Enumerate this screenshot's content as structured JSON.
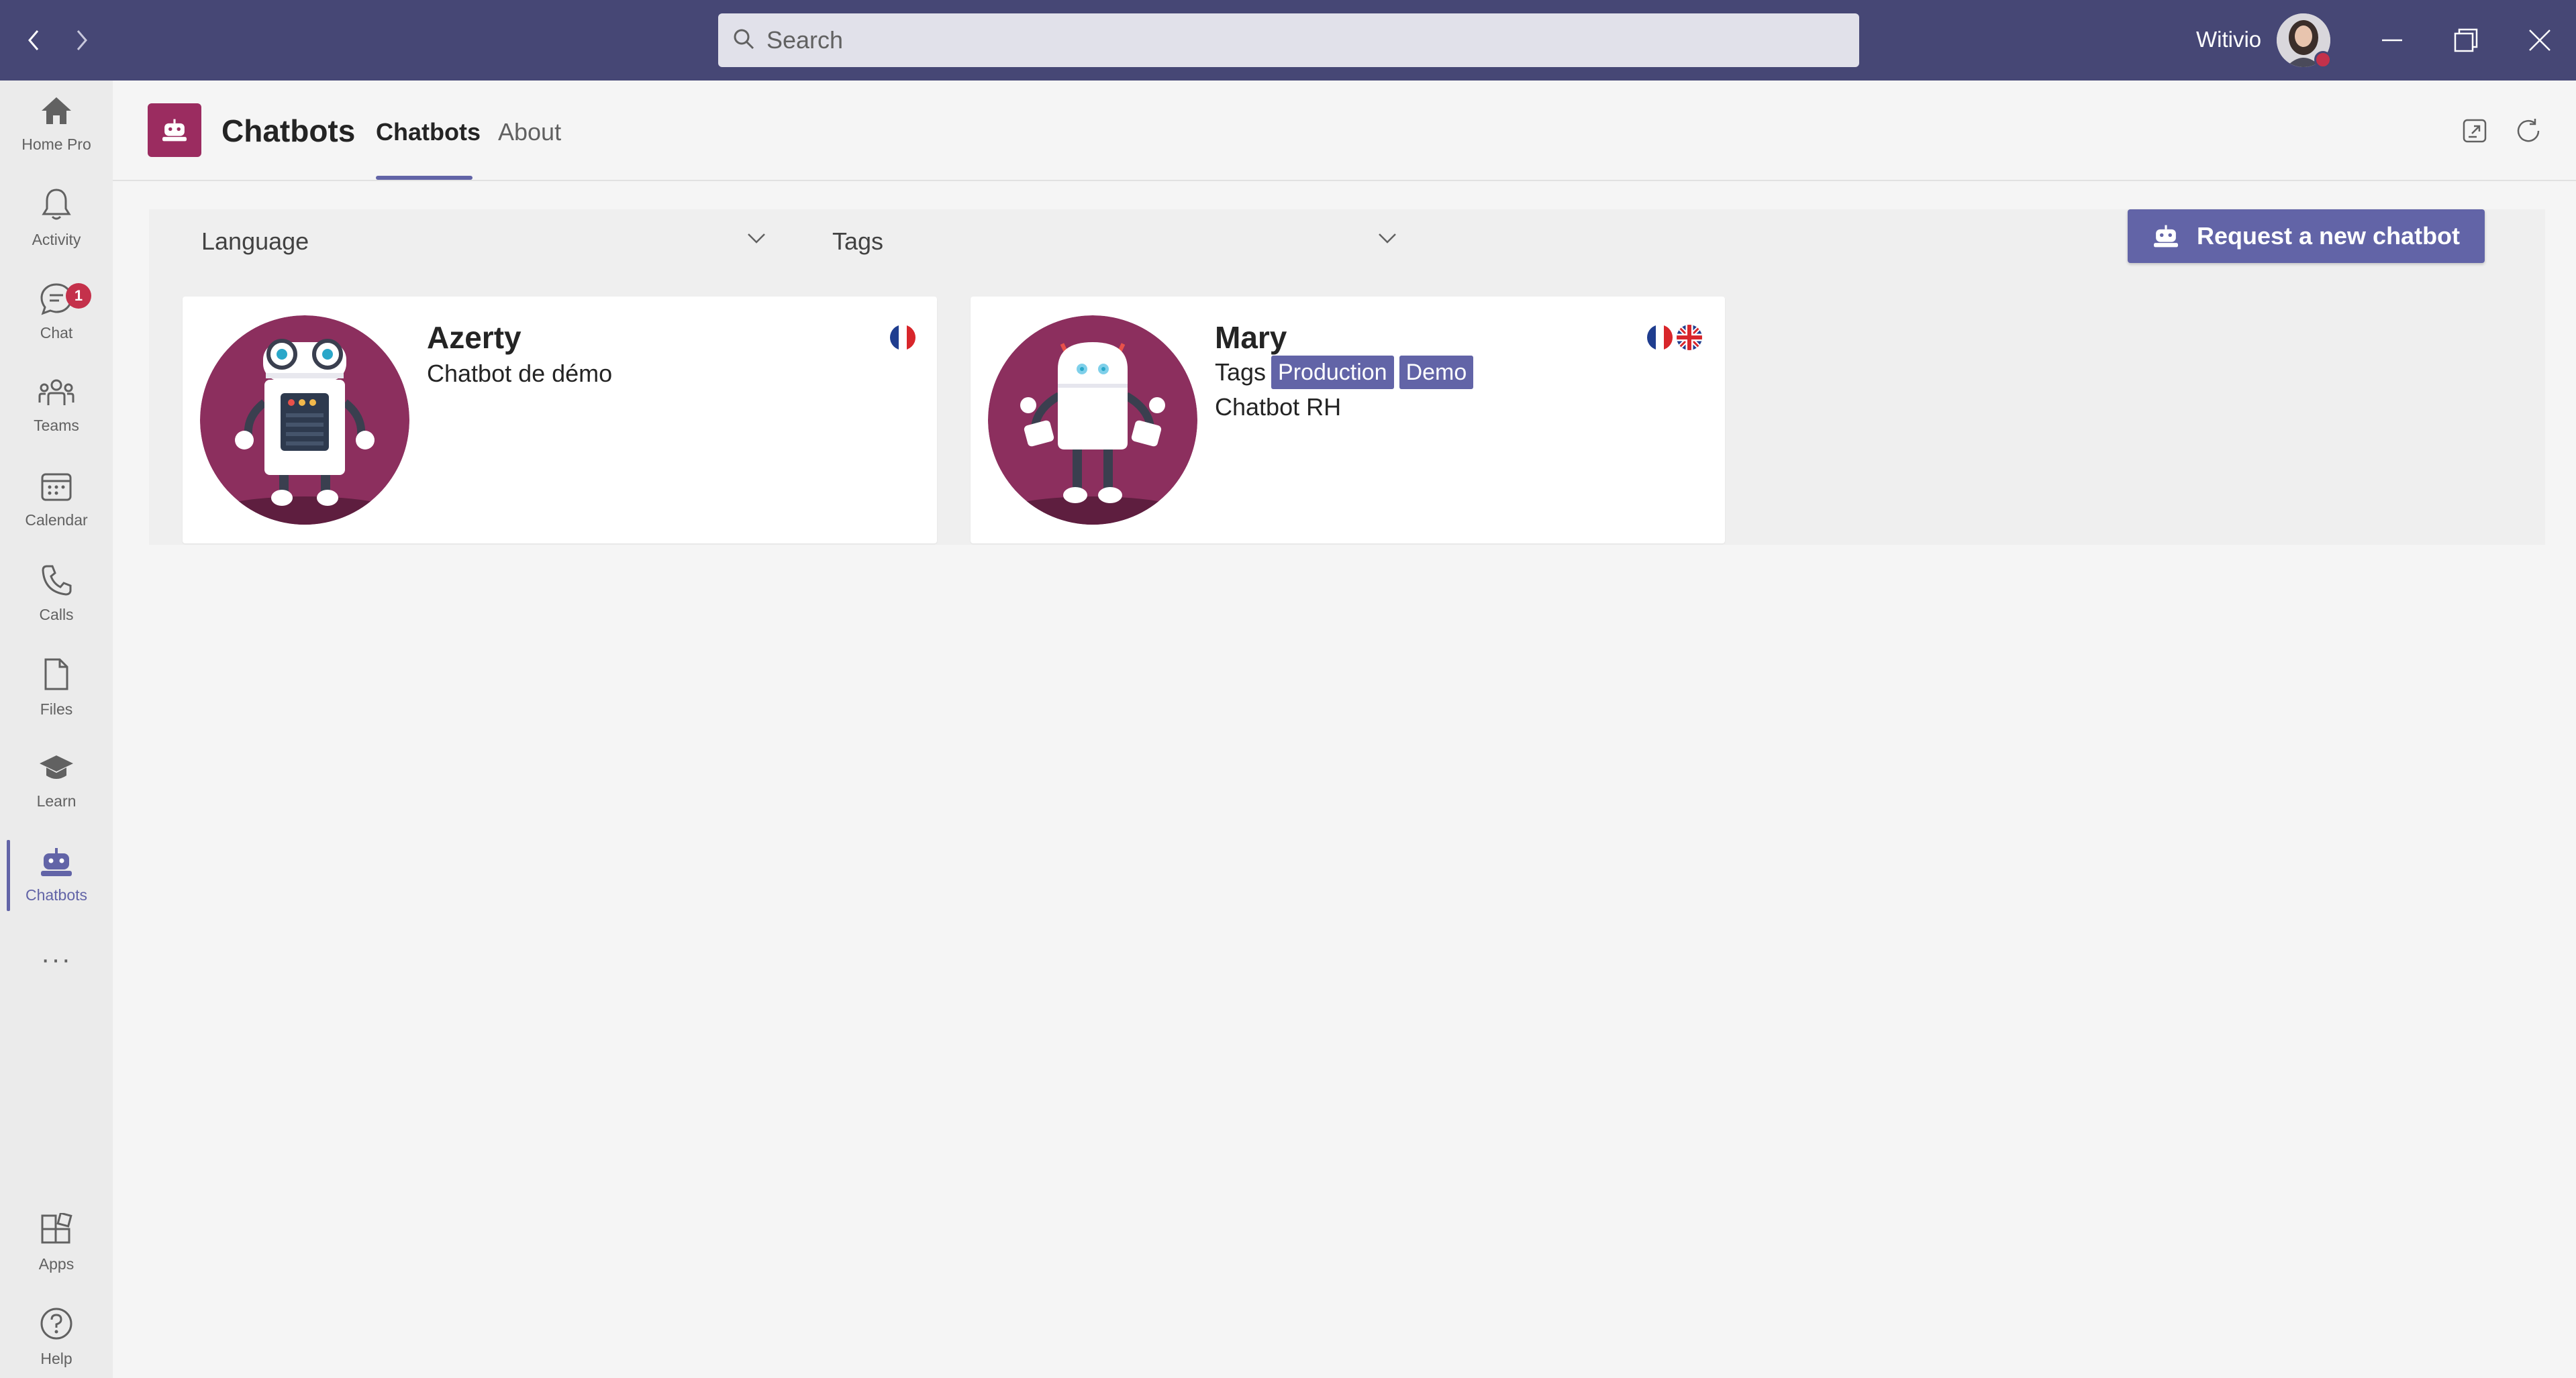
{
  "titlebar": {
    "search_placeholder": "Search",
    "username": "Witivio",
    "back_icon": "chevron-left-icon",
    "forward_icon": "chevron-right-icon",
    "colors": {
      "titlebar": "#464775",
      "accent": "#6264a7",
      "status_busy": "#c4314b"
    }
  },
  "rail": {
    "items": [
      {
        "label": "Home Pro",
        "icon": "home-icon"
      },
      {
        "label": "Activity",
        "icon": "bell-icon"
      },
      {
        "label": "Chat",
        "icon": "chat-icon",
        "badge": "1"
      },
      {
        "label": "Teams",
        "icon": "teams-icon"
      },
      {
        "label": "Calendar",
        "icon": "calendar-icon"
      },
      {
        "label": "Calls",
        "icon": "phone-icon"
      },
      {
        "label": "Files",
        "icon": "file-icon"
      },
      {
        "label": "Learn",
        "icon": "graduation-cap-icon"
      },
      {
        "label": "Chatbots",
        "icon": "robot-icon",
        "active": true
      }
    ],
    "more_label": "···",
    "bottom": [
      {
        "label": "Apps",
        "icon": "apps-icon"
      },
      {
        "label": "Help",
        "icon": "help-icon"
      }
    ]
  },
  "app": {
    "title": "Chatbots",
    "tabs": [
      {
        "label": "Chatbots",
        "active": true
      },
      {
        "label": "About",
        "active": false
      }
    ],
    "app_color": "#9b2c60"
  },
  "filters": {
    "language_label": "Language",
    "tags_label": "Tags",
    "request_button": "Request a new chatbot"
  },
  "bots": [
    {
      "name": "Azerty",
      "description": "Chatbot de démo",
      "languages": [
        "fr"
      ],
      "tags": []
    },
    {
      "name": "Mary",
      "tags_label": "Tags",
      "tags": [
        "Production",
        "Demo"
      ],
      "description": "Chatbot RH",
      "languages": [
        "fr",
        "en"
      ]
    }
  ]
}
